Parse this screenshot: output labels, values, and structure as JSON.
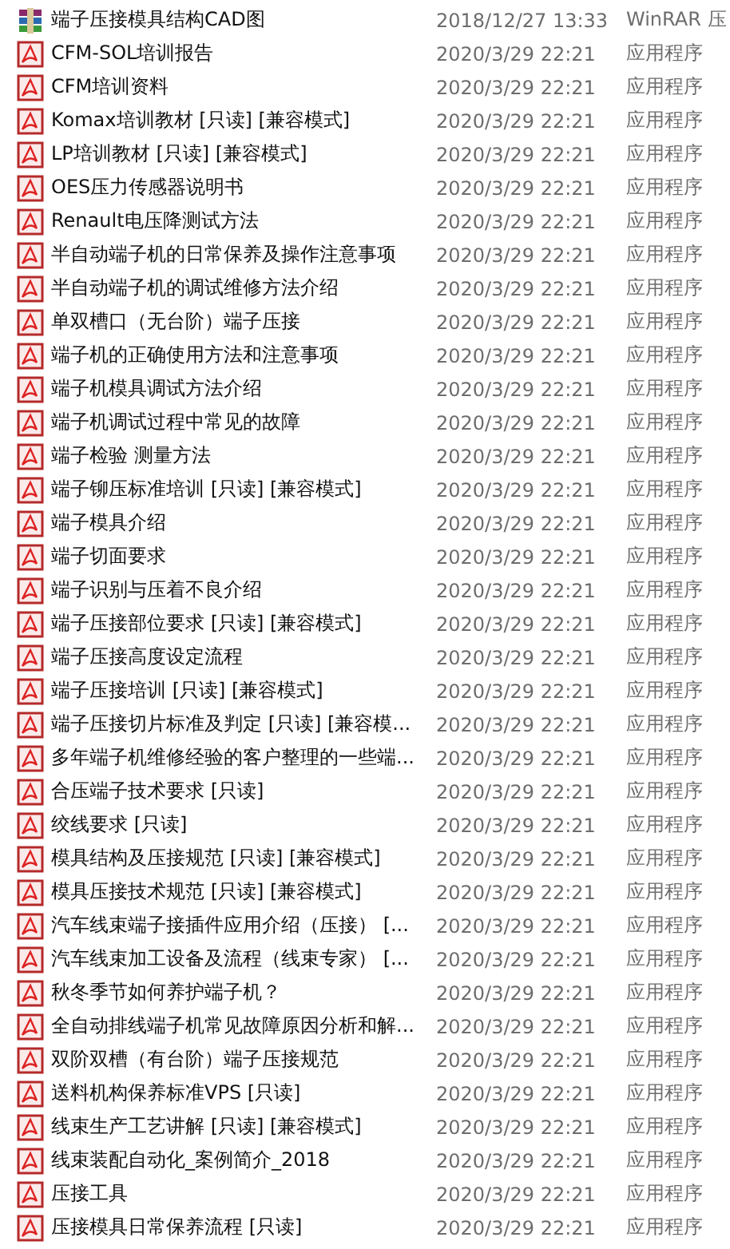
{
  "files": [
    {
      "kind": "archive",
      "name": "端子压接模具结构CAD图",
      "modified": "2018/12/27 13:33",
      "type": "WinRAR 压"
    },
    {
      "kind": "pdf",
      "name": "CFM-SOL培训报告",
      "modified": "2020/3/29 22:21",
      "type": "应用程序"
    },
    {
      "kind": "pdf",
      "name": "CFM培训资料",
      "modified": "2020/3/29 22:21",
      "type": "应用程序"
    },
    {
      "kind": "pdf",
      "name": "Komax培训教材 [只读] [兼容模式]",
      "modified": "2020/3/29 22:21",
      "type": "应用程序"
    },
    {
      "kind": "pdf",
      "name": "LP培训教材 [只读] [兼容模式]",
      "modified": "2020/3/29 22:21",
      "type": "应用程序"
    },
    {
      "kind": "pdf",
      "name": "OES压力传感器说明书",
      "modified": "2020/3/29 22:21",
      "type": "应用程序"
    },
    {
      "kind": "pdf",
      "name": "Renault电压降测试方法",
      "modified": "2020/3/29 22:21",
      "type": "应用程序"
    },
    {
      "kind": "pdf",
      "name": "半自动端子机的日常保养及操作注意事项",
      "modified": "2020/3/29 22:21",
      "type": "应用程序"
    },
    {
      "kind": "pdf",
      "name": "半自动端子机的调试维修方法介绍",
      "modified": "2020/3/29 22:21",
      "type": "应用程序"
    },
    {
      "kind": "pdf",
      "name": "单双槽口（无台阶）端子压接",
      "modified": "2020/3/29 22:21",
      "type": "应用程序"
    },
    {
      "kind": "pdf",
      "name": "端子机的正确使用方法和注意事项",
      "modified": "2020/3/29 22:21",
      "type": "应用程序"
    },
    {
      "kind": "pdf",
      "name": "端子机模具调试方法介绍",
      "modified": "2020/3/29 22:21",
      "type": "应用程序"
    },
    {
      "kind": "pdf",
      "name": "端子机调试过程中常见的故障",
      "modified": "2020/3/29 22:21",
      "type": "应用程序"
    },
    {
      "kind": "pdf",
      "name": "端子检验 测量方法",
      "modified": "2020/3/29 22:21",
      "type": "应用程序"
    },
    {
      "kind": "pdf",
      "name": "端子铆压标准培训 [只读] [兼容模式]",
      "modified": "2020/3/29 22:21",
      "type": "应用程序"
    },
    {
      "kind": "pdf",
      "name": "端子模具介绍",
      "modified": "2020/3/29 22:21",
      "type": "应用程序"
    },
    {
      "kind": "pdf",
      "name": "端子切面要求",
      "modified": "2020/3/29 22:21",
      "type": "应用程序"
    },
    {
      "kind": "pdf",
      "name": "端子识别与压着不良介绍",
      "modified": "2020/3/29 22:21",
      "type": "应用程序"
    },
    {
      "kind": "pdf",
      "name": "端子压接部位要求 [只读] [兼容模式]",
      "modified": "2020/3/29 22:21",
      "type": "应用程序"
    },
    {
      "kind": "pdf",
      "name": "端子压接高度设定流程",
      "modified": "2020/3/29 22:21",
      "type": "应用程序"
    },
    {
      "kind": "pdf",
      "name": "端子压接培训 [只读] [兼容模式]",
      "modified": "2020/3/29 22:21",
      "type": "应用程序"
    },
    {
      "kind": "pdf",
      "name": "端子压接切片标准及判定 [只读] [兼容模...",
      "modified": "2020/3/29 22:21",
      "type": "应用程序"
    },
    {
      "kind": "pdf",
      "name": "多年端子机维修经验的客户整理的一些端...",
      "modified": "2020/3/29 22:21",
      "type": "应用程序"
    },
    {
      "kind": "pdf",
      "name": "合压端子技术要求 [只读]",
      "modified": "2020/3/29 22:21",
      "type": "应用程序"
    },
    {
      "kind": "pdf",
      "name": "绞线要求 [只读]",
      "modified": "2020/3/29 22:21",
      "type": "应用程序"
    },
    {
      "kind": "pdf",
      "name": "模具结构及压接规范 [只读] [兼容模式]",
      "modified": "2020/3/29 22:21",
      "type": "应用程序"
    },
    {
      "kind": "pdf",
      "name": "模具压接技术规范 [只读] [兼容模式]",
      "modified": "2020/3/29 22:21",
      "type": "应用程序"
    },
    {
      "kind": "pdf",
      "name": "汽车线束端子接插件应用介绍（压接） [...",
      "modified": "2020/3/29 22:21",
      "type": "应用程序"
    },
    {
      "kind": "pdf",
      "name": "汽车线束加工设备及流程（线束专家） [...",
      "modified": "2020/3/29 22:21",
      "type": "应用程序"
    },
    {
      "kind": "pdf",
      "name": "秋冬季节如何养护端子机？",
      "modified": "2020/3/29 22:21",
      "type": "应用程序"
    },
    {
      "kind": "pdf",
      "name": "全自动排线端子机常见故障原因分析和解...",
      "modified": "2020/3/29 22:21",
      "type": "应用程序"
    },
    {
      "kind": "pdf",
      "name": "双阶双槽（有台阶）端子压接规范",
      "modified": "2020/3/29 22:21",
      "type": "应用程序"
    },
    {
      "kind": "pdf",
      "name": "送料机构保养标准VPS [只读]",
      "modified": "2020/3/29 22:21",
      "type": "应用程序"
    },
    {
      "kind": "pdf",
      "name": "线束生产工艺讲解 [只读] [兼容模式]",
      "modified": "2020/3/29 22:21",
      "type": "应用程序"
    },
    {
      "kind": "pdf",
      "name": "线束装配自动化_案例简介_2018",
      "modified": "2020/3/29 22:21",
      "type": "应用程序"
    },
    {
      "kind": "pdf",
      "name": "压接工具",
      "modified": "2020/3/29 22:21",
      "type": "应用程序"
    },
    {
      "kind": "pdf",
      "name": "压接模具日常保养流程 [只读]",
      "modified": "2020/3/29 22:21",
      "type": "应用程序"
    }
  ]
}
